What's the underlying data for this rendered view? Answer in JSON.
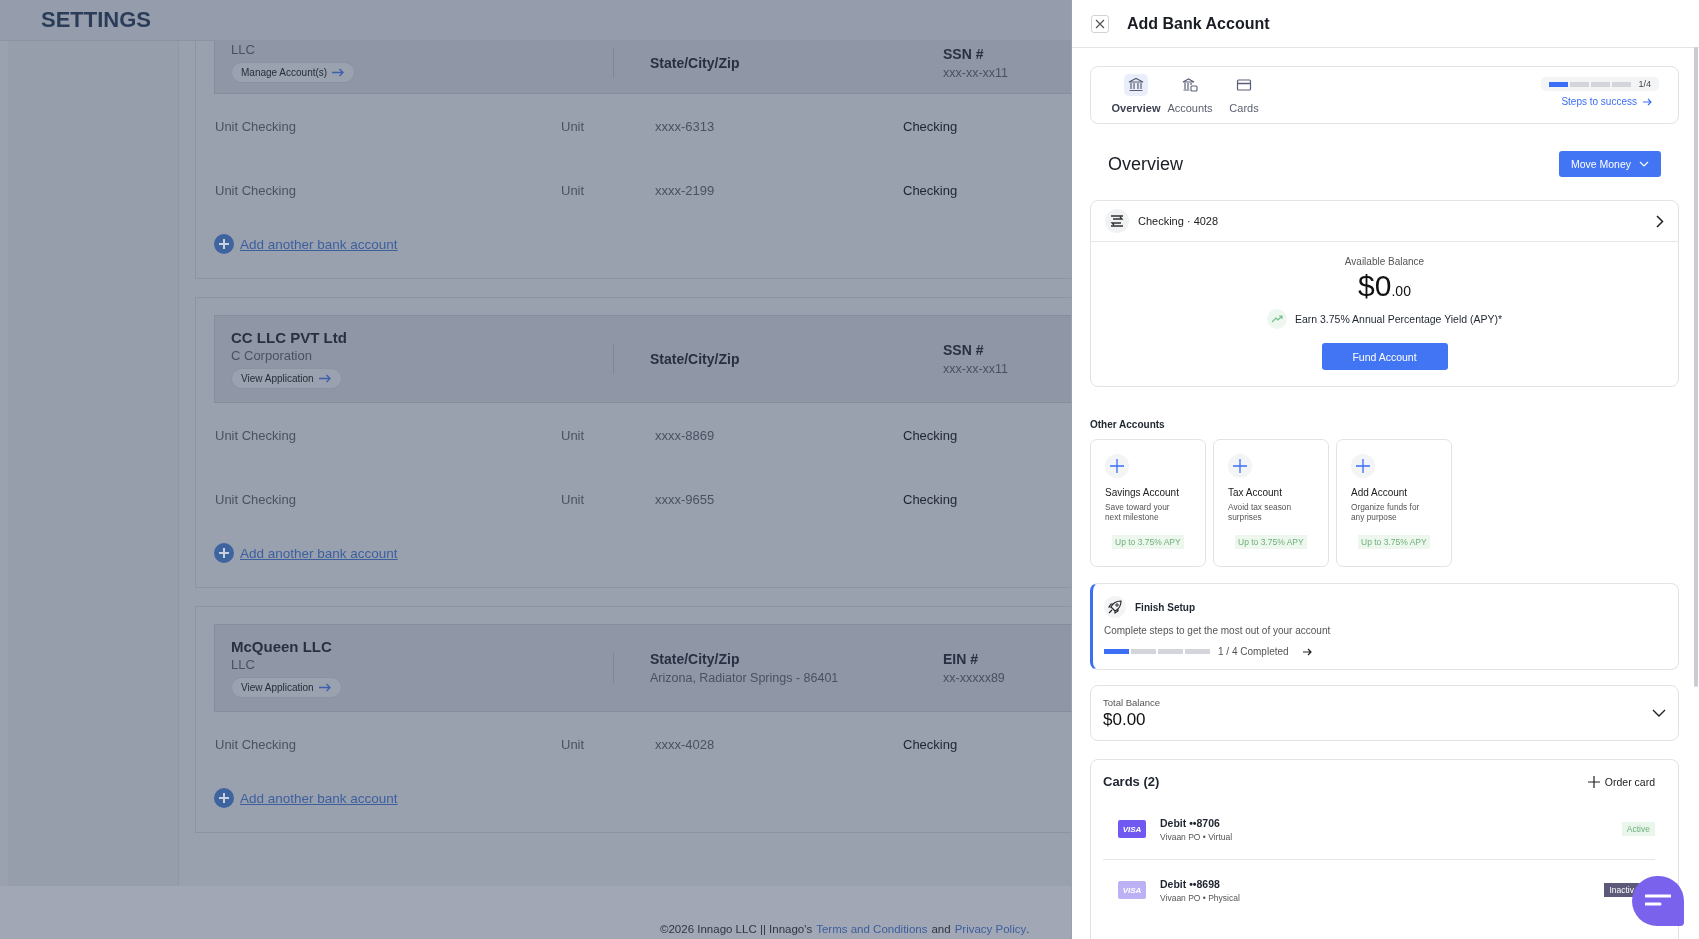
{
  "page": {
    "title": "SETTINGS"
  },
  "businesses": [
    {
      "type": "LLC",
      "action": "Manage Account(s)",
      "location_label": "State/City/Zip",
      "id_label": "SSN #",
      "id_value": "xxx-xx-xx11",
      "accounts": [
        {
          "name": "Unit Checking",
          "bank": "Unit",
          "number": "xxxx-6313",
          "type": "Checking"
        },
        {
          "name": "Unit Checking",
          "bank": "Unit",
          "number": "xxxx-2199",
          "type": "Checking"
        }
      ],
      "add_link": "Add another bank account"
    },
    {
      "name": "CC LLC PVT Ltd",
      "type": "C Corporation",
      "action": "View Application",
      "location_label": "State/City/Zip",
      "id_label": "SSN #",
      "id_value": "xxx-xx-xx11",
      "accounts": [
        {
          "name": "Unit Checking",
          "bank": "Unit",
          "number": "xxxx-8869",
          "type": "Checking"
        },
        {
          "name": "Unit Checking",
          "bank": "Unit",
          "number": "xxxx-9655",
          "type": "Checking"
        }
      ],
      "add_link": "Add another bank account"
    },
    {
      "name": "McQueen LLC",
      "type": "LLC",
      "action": "View Application",
      "location_label": "State/City/Zip",
      "location": "Arizona, Radiator Springs - 86401",
      "id_label": "EIN #",
      "id_value": "xx-xxxxx89",
      "accounts": [
        {
          "name": "Unit Checking",
          "bank": "Unit",
          "number": "xxxx-4028",
          "type": "Checking"
        }
      ],
      "add_link": "Add another bank account"
    }
  ],
  "footer": {
    "copyright": "©2026 Innago LLC || Innago's",
    "terms": "Terms and Conditions",
    "and": "and",
    "privacy": "Privacy Policy",
    "end": "."
  },
  "panel": {
    "title": "Add Bank Account",
    "tabs": [
      {
        "label": "Overview",
        "selected": true
      },
      {
        "label": "Accounts",
        "selected": false
      },
      {
        "label": "Cards",
        "selected": false
      }
    ],
    "steps": {
      "level": 0.25,
      "count": "1/4",
      "link": "Steps to success"
    },
    "overview_heading": "Overview",
    "move_money": "Move Money",
    "account": {
      "name": "Checking · 4028",
      "balance_label": "Available Balance",
      "balance_whole": "$0",
      "balance_cents": ".00",
      "apy_text": "Earn 3.75% Annual Percentage Yield (APY)*",
      "fund_button": "Fund Account"
    },
    "other_heading": "Other Accounts",
    "other_accounts": [
      {
        "title": "Savings Account",
        "desc": "Save toward your next milestone",
        "apy": "Up to 3.75% APY"
      },
      {
        "title": "Tax Account",
        "desc": "Avoid tax season surprises",
        "apy": "Up to 3.75% APY"
      },
      {
        "title": "Add Account",
        "desc": "Organize funds for any purpose",
        "apy": "Up to 3.75% APY"
      }
    ],
    "finish": {
      "title": "Finish Setup",
      "desc": "Complete steps to get the most out of your account",
      "level": 0.25,
      "progress": "1 / 4 Completed"
    },
    "total": {
      "label": "Total Balance",
      "value": "$0.00",
      "expanded": false
    },
    "cards": {
      "heading": "Cards (2)",
      "order": "Order card",
      "items": [
        {
          "brand": "VISA",
          "name": "Debit ••8706",
          "detail": "Vivaan PO • Virtual",
          "status": "Active",
          "active": true
        },
        {
          "brand": "VISA",
          "name": "Debit ••8698",
          "detail": "Vivaan PO • Physical",
          "status": "Inactiv",
          "active": false
        }
      ]
    }
  }
}
